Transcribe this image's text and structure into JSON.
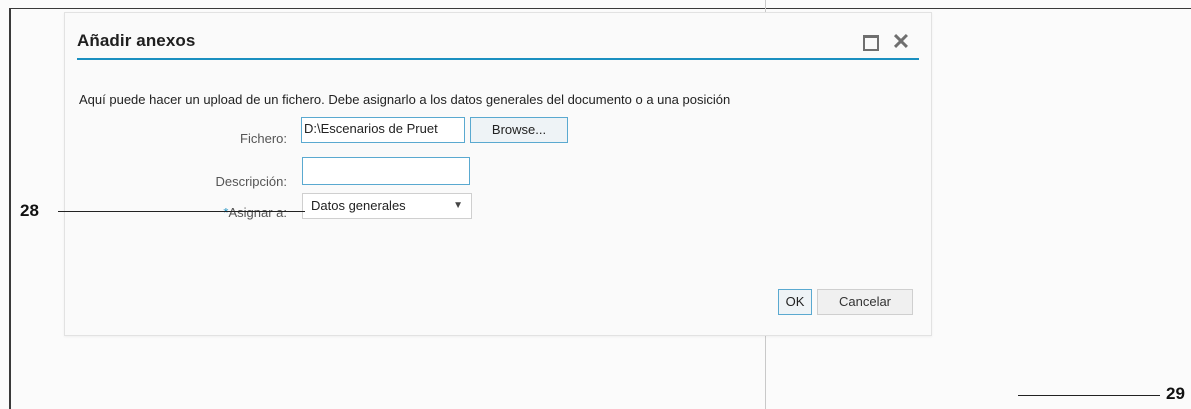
{
  "dialog": {
    "title": "Añadir anexos",
    "intro": "Aquí puede hacer un upload de un fichero. Debe asignarlo a los datos generales del documento o a una posición",
    "file_label": "Fichero:",
    "file_value": "D:\\Escenarios de Pruet",
    "browse_label": "Browse...",
    "description_label": "Descripción:",
    "description_value": "",
    "assign_required_mark": "*",
    "assign_label": "Asignar a:",
    "assign_selected": "Datos generales",
    "ok_label": "OK",
    "cancel_label": "Cancelar",
    "icons": {
      "maximize": "maximize-icon",
      "close": "close-icon",
      "dropdown": "chevron-down-icon"
    },
    "accent_color": "#1a8fc0"
  },
  "callouts": {
    "c28": "28",
    "c29": "29"
  }
}
